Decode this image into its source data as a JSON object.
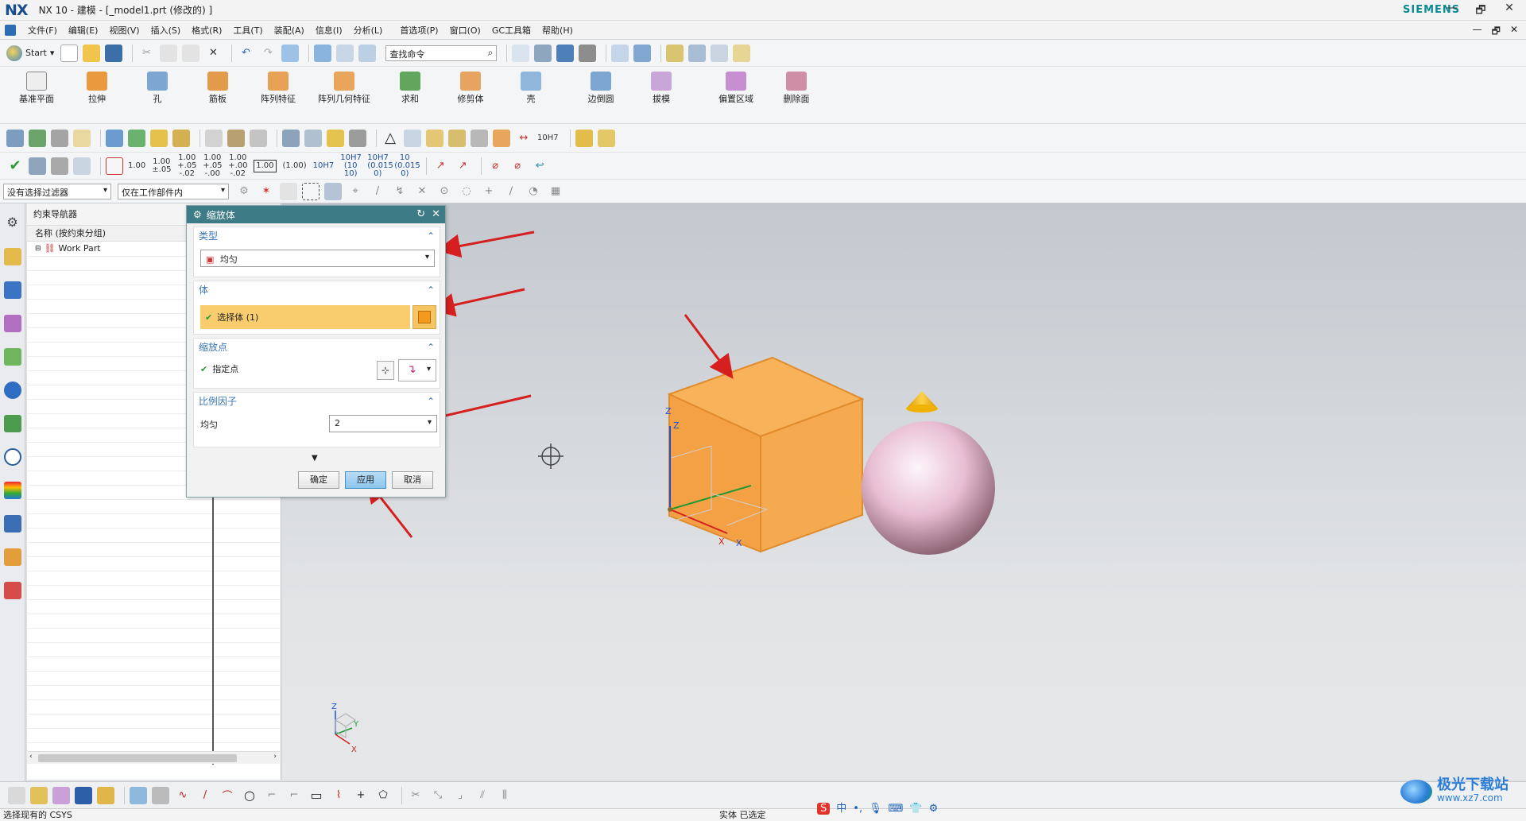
{
  "window": {
    "logo": "NX",
    "title": "NX 10 - 建模 - [_model1.prt  (修改的) ]",
    "brand": "SIEMENS",
    "controls": [
      "—",
      "🗗",
      "✕"
    ]
  },
  "menu": {
    "items": [
      "文件(F)",
      "编辑(E)",
      "视图(V)",
      "插入(S)",
      "格式(R)",
      "工具(T)",
      "装配(A)",
      "信息(I)",
      "分析(L)",
      "首选项(P)",
      "窗口(O)",
      "GC工具箱",
      "帮助(H)"
    ],
    "controls": [
      "—",
      "🗗",
      "✕"
    ]
  },
  "toolbar1": {
    "start_label": "Start",
    "command_search_placeholder": "查找命令"
  },
  "feature_toolbar": {
    "buttons": [
      "基准平面",
      "拉伸",
      "孔",
      "筋板",
      "阵列特征",
      "阵列几何特征",
      "求和",
      "修剪体",
      "壳",
      "边倒圆",
      "拔模",
      "偏置区域",
      "删除面"
    ]
  },
  "pmi_toolbar": {
    "values": [
      "1.00",
      "1.00 ±.05",
      "1.00 +.05 -.02",
      "1.00 +.05 -.00",
      "1.00 +.00 -.02",
      "1.00",
      "(1.00)",
      "10H7",
      "10H7 (10 10)",
      "10H7 (0.015 0)",
      "10 (0.015 0)"
    ],
    "hole_fit": "10H7"
  },
  "selection_bar": {
    "filter": "没有选择过滤器",
    "scope": "仅在工作部件内"
  },
  "navigator": {
    "title": "约束导航器",
    "column_header": "名称 (按约束分组)",
    "root": "Work Part"
  },
  "dialog": {
    "title": "缩放体",
    "type_section": "类型",
    "type_value": "均匀",
    "body_section": "体",
    "select_body": "选择体 (1)",
    "scale_point_section": "缩放点",
    "specify_point": "指定点",
    "factor_section": "比例因子",
    "factor_label": "均匀",
    "factor_value": "2",
    "ok": "确定",
    "apply": "应用",
    "cancel": "取消"
  },
  "viewport": {
    "triad_labels": {
      "z": "Z",
      "y": "Y",
      "x": "X"
    },
    "object_colors": {
      "cube": "#f6a94a",
      "sphere": "#e9c1d6",
      "cone": "#f5b800",
      "arrow": "#d62020"
    }
  },
  "status": {
    "left": "选择现有的 CSYS",
    "middle": "实体 已选定"
  },
  "watermark": {
    "name": "极光下载站",
    "url": "www.xz7.com"
  }
}
